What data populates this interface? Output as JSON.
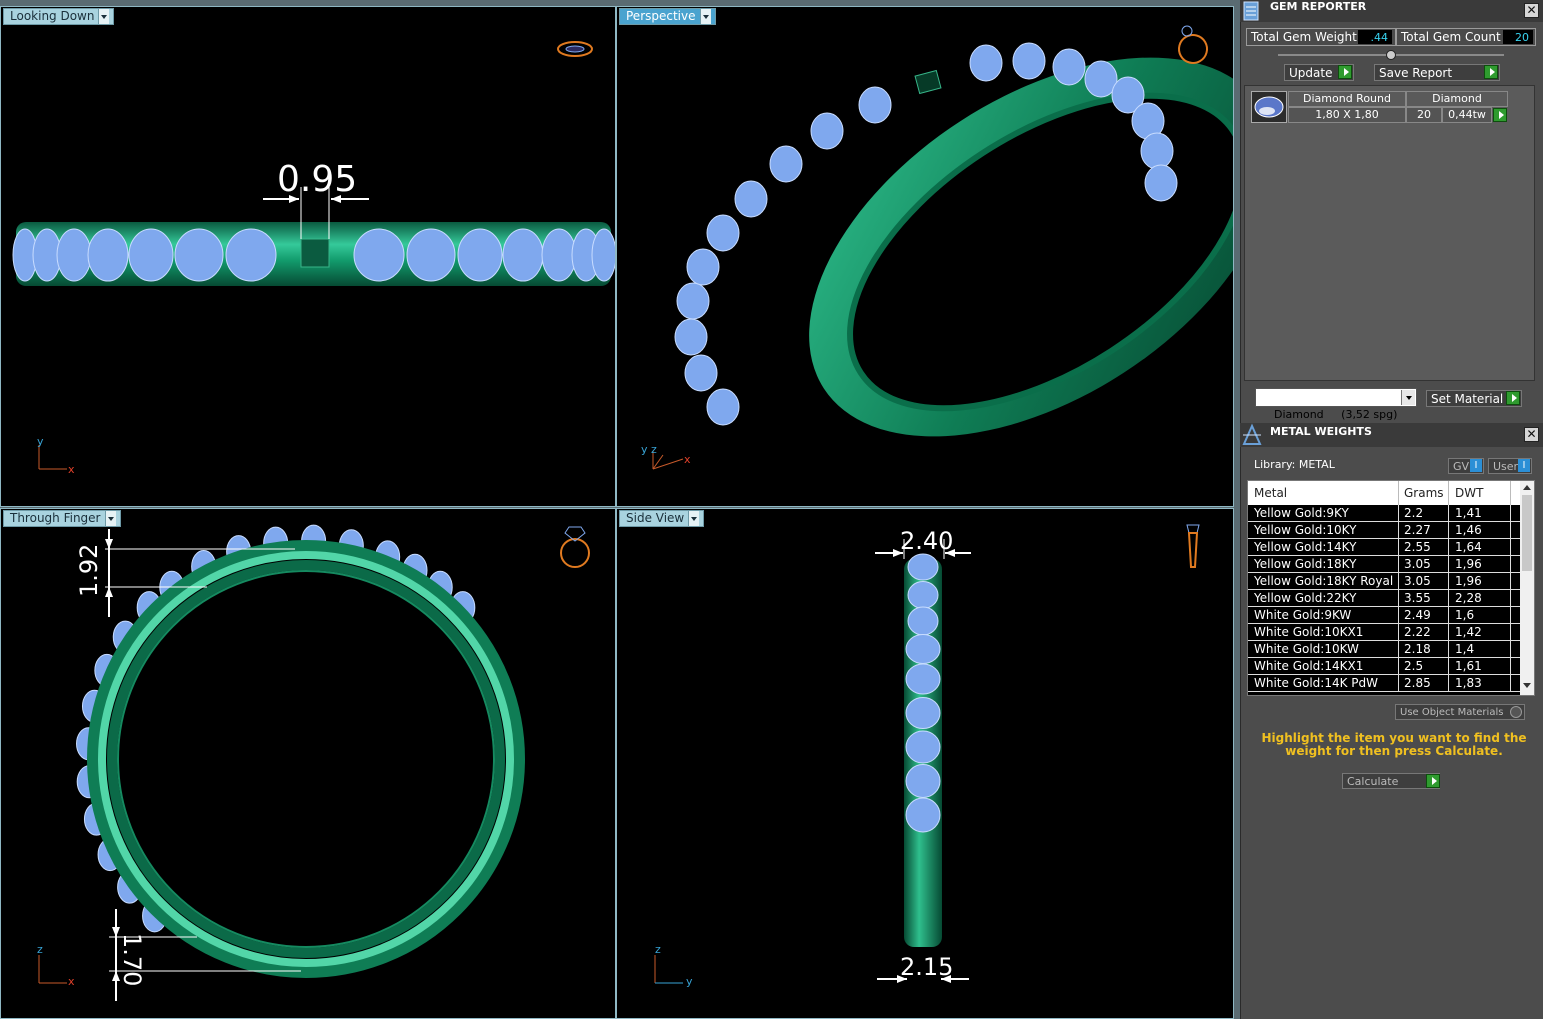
{
  "viewports": {
    "top_left": {
      "label": "Looking Down",
      "dimension": "0.95",
      "axis_v": "y",
      "axis_h": "x"
    },
    "top_right": {
      "label": "Perspective",
      "axis_v": "y z",
      "axis_h": "x"
    },
    "bottom_left": {
      "label": "Through Finger",
      "dimension_top": "1.92",
      "dimension_bottom": "1.70",
      "axis_v": "z",
      "axis_h": "x"
    },
    "bottom_right": {
      "label": "Side View",
      "dimension_top": "2.40",
      "dimension_bottom": "2.15",
      "axis_v": "z",
      "axis_h": "y"
    }
  },
  "gem_reporter": {
    "title": "GEM REPORTER",
    "close": "✕",
    "total_weight_label": "Total Gem Weight",
    "total_weight_value": ".44",
    "total_count_label": "Total Gem Count",
    "total_count_value": "20",
    "update_label": "Update",
    "save_report_label": "Save Report",
    "gem": {
      "name": "Diamond Round",
      "material": "Diamond",
      "size": "1,80 X 1,80",
      "count": "20",
      "weight": "0,44tw"
    },
    "material_select": "Diamond     (3,52 spg)",
    "set_material_label": "Set Material"
  },
  "metal_weights": {
    "title": "METAL WEIGHTS",
    "close": "✕",
    "library_label": "Library: METAL",
    "gv_label": "GV",
    "user_label": "User",
    "columns": [
      "Metal",
      "Grams",
      "DWT"
    ],
    "rows": [
      [
        "Yellow Gold:9KY",
        "2.2",
        "1,41"
      ],
      [
        "Yellow Gold:10KY",
        "2.27",
        "1,46"
      ],
      [
        "Yellow Gold:14KY",
        "2.55",
        "1,64"
      ],
      [
        "Yellow Gold:18KY",
        "3.05",
        "1,96"
      ],
      [
        "Yellow Gold:18KY Royal",
        "3.05",
        "1,96"
      ],
      [
        "Yellow Gold:22KY",
        "3.55",
        "2,28"
      ],
      [
        "White Gold:9KW",
        "2.49",
        "1,6"
      ],
      [
        "White Gold:10KX1",
        "2.22",
        "1,42"
      ],
      [
        "White Gold:10KW",
        "2.18",
        "1,4"
      ],
      [
        "White Gold:14KX1",
        "2.5",
        "1,61"
      ],
      [
        "White Gold:14K PdW",
        "2.85",
        "1,83"
      ]
    ],
    "use_object_materials": "Use Object Materials",
    "hint": "Highlight the item you want to find the weight for then press Calculate.",
    "calculate_label": "Calculate"
  },
  "colors": {
    "metal": "#0f7d55",
    "gem": "#7fa8ee",
    "accent_cyan": "#38d3f0",
    "hint": "#f0c020"
  }
}
